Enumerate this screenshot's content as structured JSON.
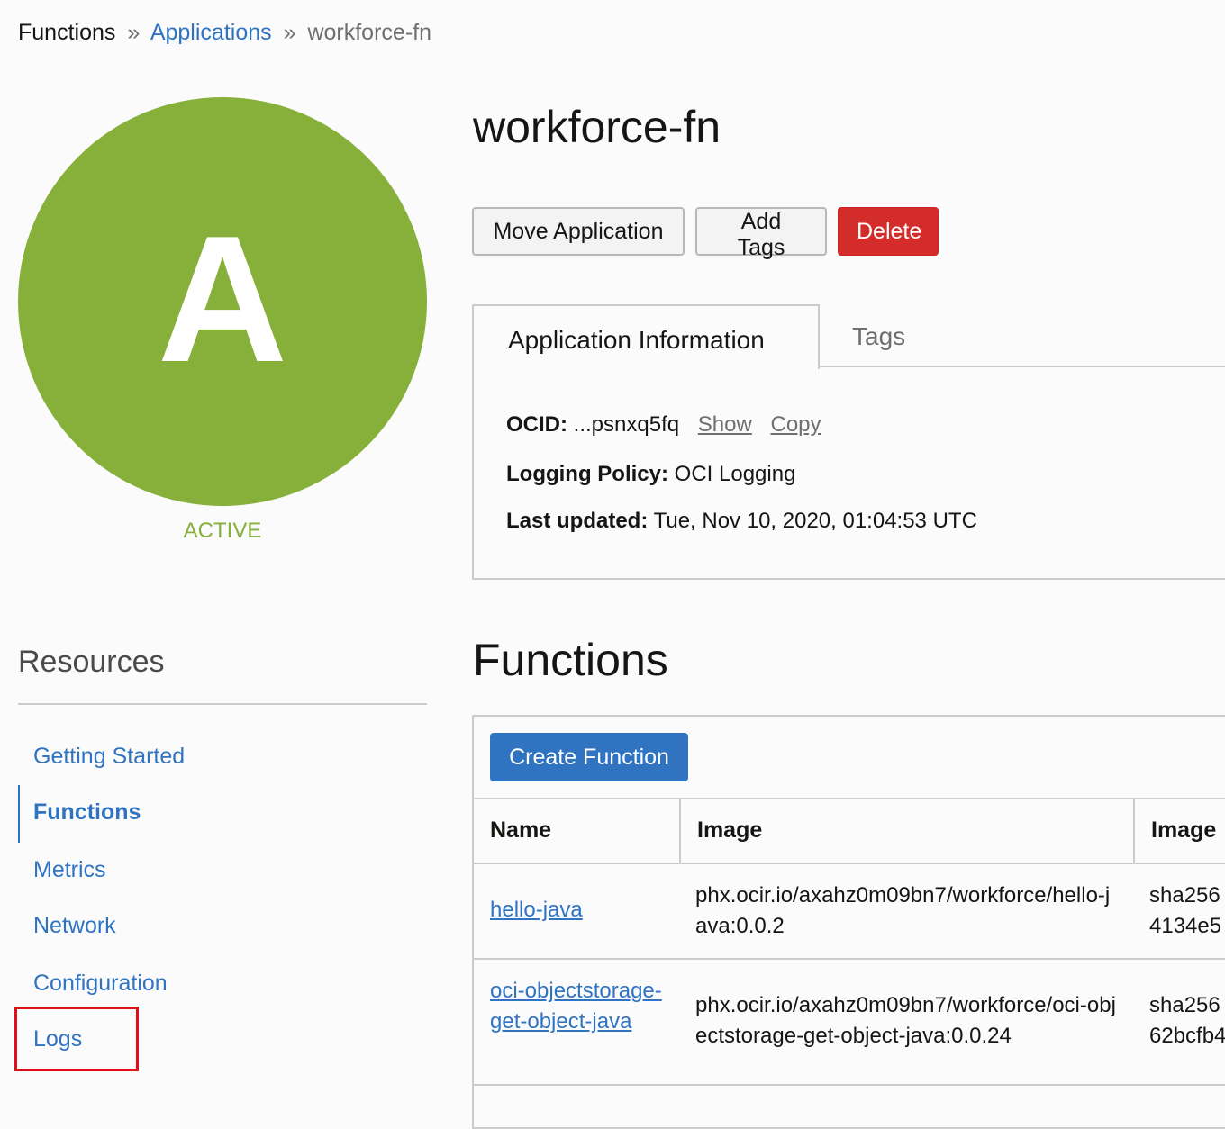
{
  "breadcrumb": {
    "root": "Functions",
    "separator": "»",
    "applications": "Applications",
    "current": "workforce-fn"
  },
  "avatar": {
    "letter": "A",
    "color": "#87b03b"
  },
  "status": "ACTIVE",
  "title": "workforce-fn",
  "actions": {
    "move": "Move Application",
    "add_tags": "Add Tags",
    "delete": "Delete"
  },
  "tabs": {
    "app_info": "Application Information",
    "tags": "Tags"
  },
  "info": {
    "ocid_label": "OCID:",
    "ocid_value": "...psnxq5fq",
    "show": "Show",
    "copy": "Copy",
    "logging_label": "Logging Policy:",
    "logging_value": "OCI Logging",
    "updated_label": "Last updated:",
    "updated_value": "Tue, Nov 10, 2020, 01:04:53 UTC"
  },
  "functions": {
    "heading": "Functions",
    "create_button": "Create Function",
    "columns": [
      "Name",
      "Image",
      "Image"
    ],
    "rows": [
      {
        "name": "hello-java",
        "image": "phx.ocir.io/axahz0m09bn7/workforce/hello-java:0.0.2",
        "digest_line1": "sha256",
        "digest_line2": "4134e5"
      },
      {
        "name": "oci-objectstorage-get-object-java",
        "image": "phx.ocir.io/axahz0m09bn7/workforce/oci-objectstorage-get-object-java:0.0.24",
        "digest_line1": "sha256",
        "digest_line2": "62bcfb4"
      }
    ]
  },
  "resources": {
    "heading": "Resources",
    "items": [
      "Getting Started",
      "Functions",
      "Metrics",
      "Network",
      "Configuration",
      "Logs"
    ],
    "active": "Functions",
    "highlighted": "Logs"
  },
  "colors": {
    "accent": "#2f73c1",
    "danger": "#d42b2b",
    "active": "#87b03b",
    "highlight": "#e0101a"
  }
}
